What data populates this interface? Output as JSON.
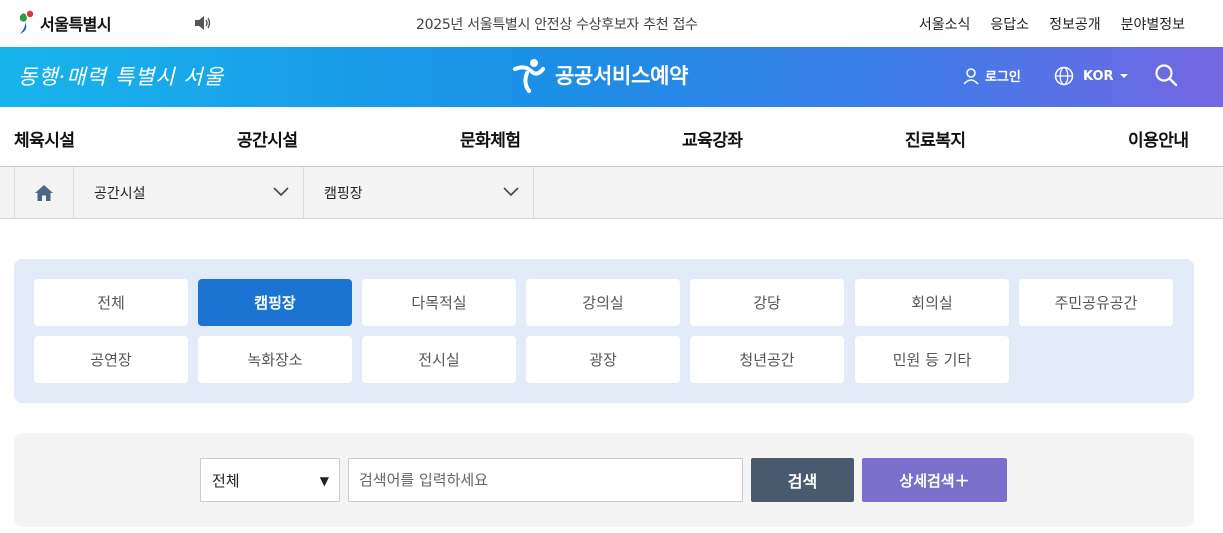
{
  "topbar": {
    "logo_text": "서울특별시",
    "notice": "2025년 서울특별시 안전상 수상후보자 추천 접수",
    "links": [
      "서울소식",
      "응답소",
      "정보공개",
      "분야별정보"
    ]
  },
  "hero": {
    "slogan": "동행·매력 특별시 서울",
    "service_title": "공공서비스예약",
    "login_label": "로그인",
    "lang_label": "KOR"
  },
  "mainnav": {
    "items": [
      "체육시설",
      "공간시설",
      "문화체험",
      "교육강좌",
      "진료복지",
      "이용안내"
    ]
  },
  "breadcrumb": {
    "level1": "공간시설",
    "level2": "캠핑장"
  },
  "categories": {
    "items": [
      "전체",
      "캠핑장",
      "다목적실",
      "강의실",
      "강당",
      "회의실",
      "주민공유공간",
      "공연장",
      "녹화장소",
      "전시실",
      "광장",
      "청년공간",
      "민원 등 기타"
    ],
    "active": "캠핑장"
  },
  "search": {
    "select_value": "전체",
    "placeholder": "검색어를 입력하세요",
    "search_label": "검색",
    "detail_label": "상세검색＋"
  },
  "colors": {
    "accent": "#1b74d2",
    "search_btn": "#4a5a6e",
    "detail_btn": "#7a6fcb",
    "panel_bg": "#e3ebf8"
  }
}
